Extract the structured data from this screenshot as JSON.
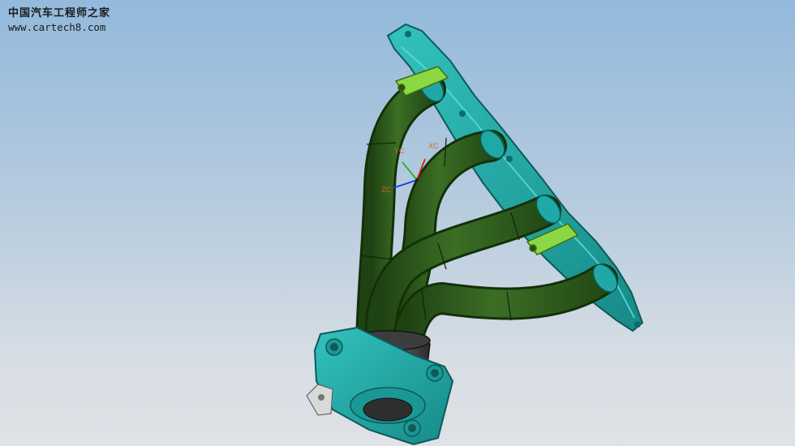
{
  "watermark": {
    "title": "中国汽车工程师之家",
    "url": "www.cartech8.com"
  },
  "triad": {
    "x_label": "XC",
    "y_label": "YC",
    "z_label": "ZC"
  },
  "colors": {
    "pipe": "#2f5c1c",
    "flange": "#1fa9a6",
    "bracket": "#8bd845",
    "background_top": "#93b9dc",
    "background_bottom": "#dfe2e6"
  }
}
